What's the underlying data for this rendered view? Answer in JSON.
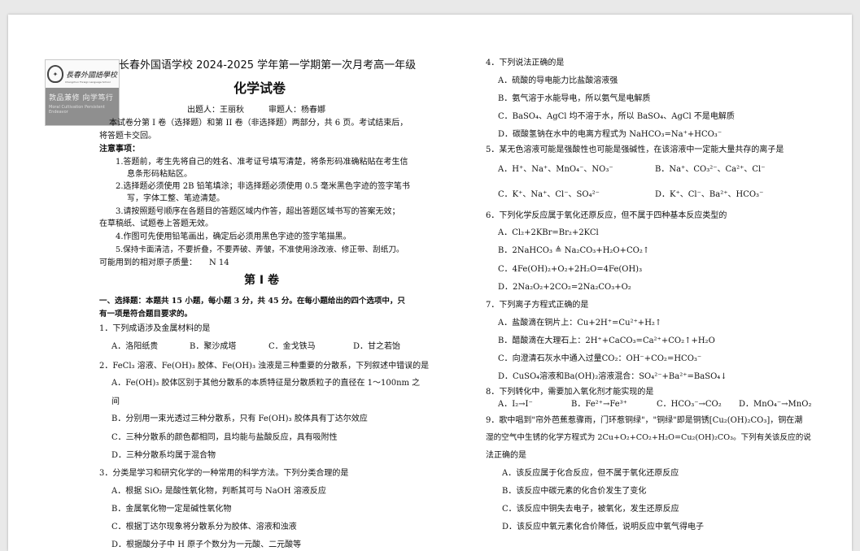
{
  "exam": {
    "title": "长春外国语学校 2024-2025 学年第一学期第一次月考高一年级",
    "subject": "化学试卷",
    "authors": "出题人：王丽秋　　　审题人：杨春娜",
    "intro_1": "本试卷分第 I 卷（选择题）和第 II 卷（非选择题）两部分，共 6 页。考试结束后，",
    "intro_2": "将答题卡交回。",
    "notice_heading": "注意事项：",
    "notes": [
      "1.答题前，考生先将自己的姓名、准考证号填写清楚，将条形码准确粘贴在考生信",
      "息条形码粘贴区。",
      "2.选择题必须使用 2B 铅笔填涂；非选择题必须使用 0.5 毫米黑色字迹的签字笔书",
      "写，字体工整、笔迹清楚。",
      "3.请按照题号顺序在各题目的答题区域内作答，超出答题区域书写的答案无效；",
      "在草稿纸、试题卷上答题无效。",
      "4.作图可先使用铅笔画出，确定后必须用黑色字迹的签字笔描黑。",
      "5.保持卡面清洁，不要折叠，不要弄破、弄皱，不准使用涂改液、修正带、刮纸刀。"
    ],
    "atomic_mass": "可能用到的相对原子质量：　　N 14",
    "section_title": "第 I 卷",
    "part1_1": "一、选择题：本题共 15 小题，每小题 3 分，共 45 分。在每小题给出的四个选项中，只",
    "part1_2": "有一项是符合题目要求的。"
  },
  "logo": {
    "script_name": "長春外國語學校",
    "english": "Changchun Foreign Language School",
    "motto": "敦品兼修  向学笃行",
    "motto_en": "Moral Cultivation  Persistent Endeavor"
  },
  "left_questions": {
    "q1": "1．下列成语涉及金属材料的是",
    "q1_opts": [
      "A．洛阳纸贵",
      "B．聚沙成塔",
      "C．金戈铁马",
      "D．甘之若饴"
    ],
    "q2": "2．FeCl₃ 溶液、Fe(OH)₃ 胶体、Fe(OH)₃ 浊液是三种重要的分散系，下列叙述中错误的是",
    "q2_a1": "A．Fe(OH)₃ 胶体区别于其他分散系的本质特征是分散质粒子的直径在 1～100nm 之",
    "q2_a2": "间",
    "q2_b": "B．分别用一束光透过三种分散系，只有 Fe(OH)₃ 胶体具有丁达尔效应",
    "q2_c": "C．三种分散系的颜色都相同，且均能与盐酸反应，具有吸附性",
    "q2_d": "D．三种分散系均属于混合物",
    "q3": "3．分类是学习和研究化学的一种常用的科学方法。下列分类合理的是",
    "q3_a": "A．根据 SiO₂ 是酸性氧化物，判断其可与 NaOH 溶液反应",
    "q3_b": "B．金属氧化物一定是碱性氧化物",
    "q3_c": "C．根据丁达尔现象将分散系分为胶体、溶液和浊液",
    "q3_d": "D．根据酸分子中 H 原子个数分为一元酸、二元酸等"
  },
  "right_questions": {
    "q4": "4．下列说法正确的是",
    "q4_a": "A．硫酸的导电能力比盐酸溶液强",
    "q4_b": "B．氨气溶于水能导电，所以氨气是电解质",
    "q4_c": "C．BaSO₄、AgCl 均不溶于水，所以 BaSO₄、AgCl 不是电解质",
    "q4_d": "D．碳酸氢钠在水中的电离方程式为 NaHCO₃=Na⁺+HCO₃⁻",
    "q5": "5．某无色溶液可能是强酸性也可能是强碱性，在该溶液中一定能大量共存的离子是",
    "q5_a": "A．H⁺、Na⁺、MnO₄⁻、NO₃⁻",
    "q5_b": "B．Na⁺、CO₃²⁻、Ca²⁺、Cl⁻",
    "q5_c": "C．K⁺、Na⁺、Cl⁻、SO₄²⁻",
    "q5_d": "D．K⁺、Cl⁻、Ba²⁺、HCO₃⁻",
    "q6": "6．下列化学反应属于氧化还原反应，但不属于四种基本反应类型的",
    "q6_a": "A．Cl₂+2KBr=Br₂+2KCl",
    "q6_b": "B．2NaHCO₃ ≜ Na₂CO₃+H₂O+CO₂↑",
    "q6_c": "C．4Fe(OH)₂+O₂+2H₂O=4Fe(OH)₃",
    "q6_d": "D．2Na₂O₂+2CO₂=2Na₂CO₃+O₂",
    "q7": "7．下列离子方程式正确的是",
    "q7_a": "A．盐酸滴在铜片上：Cu+2H⁺=Cu²⁺+H₂↑",
    "q7_b": "B．醋酸滴在大理石上：2H⁺+CaCO₃=Ca²⁺+CO₂↑+H₂O",
    "q7_c": "C．向澄清石灰水中通入过量CO₂：OH⁻+CO₂=HCO₃⁻",
    "q7_d": "D．CuSO₄溶液和Ba(OH)₂溶液混合：SO₄²⁻+Ba²⁺=BaSO₄↓",
    "q8": "8．下列转化中，需要加入氧化剂才能实现的是",
    "q8_opts": [
      "A．I₂→I⁻",
      "B．Fe²⁺→Fe³⁺",
      "C．HCO₃⁻→CO₂",
      "D．MnO₄⁻→MnO₂"
    ],
    "q9_1": "9．歌中唱到\"帘外芭蕉惹骤雨，门环惹铜绿\"，\"铜绿\"即是铜锈[Cu₂(OH)₂CO₃]，铜在潮",
    "q9_2": "湿的空气中生锈的化学方程式为 2Cu+O₂+CO₂+H₂O=Cu₂(OH)₂CO₃。下列有关该反应的说",
    "q9_3": "法正确的是",
    "q9_a": "A．该反应属于化合反应，但不属于氧化还原反应",
    "q9_b": "B．该反应中碳元素的化合价发生了变化",
    "q9_c": "C．该反应中铜失去电子，被氧化，发生还原反应",
    "q9_d": "D．该反应中氧元素化合价降低，说明反应中氧气得电子"
  }
}
